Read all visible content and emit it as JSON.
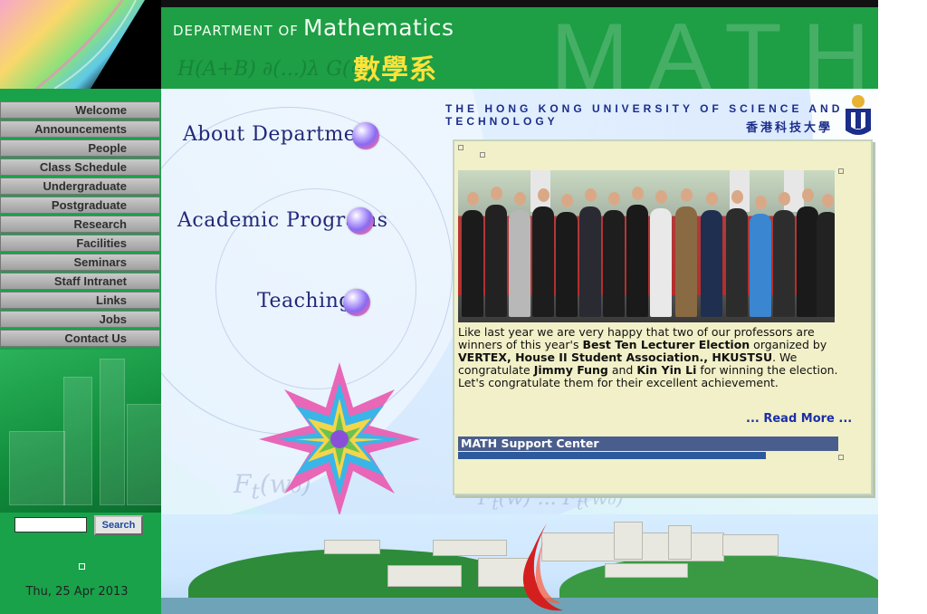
{
  "header": {
    "dept_prefix": "DEPARTMENT OF",
    "dept_name": "Mathematics",
    "dept_chinese": "數學系",
    "watermark": "MATH"
  },
  "nav": {
    "items": [
      {
        "label": "Welcome"
      },
      {
        "label": "Announcements"
      },
      {
        "label": "People"
      },
      {
        "label": "Class Schedule"
      },
      {
        "label": "Undergraduate"
      },
      {
        "label": "Postgraduate"
      },
      {
        "label": "Research"
      },
      {
        "label": "Facilities"
      },
      {
        "label": "Seminars"
      },
      {
        "label": "Staff Intranet"
      },
      {
        "label": "Links"
      },
      {
        "label": "Jobs"
      },
      {
        "label": "Contact Us"
      }
    ]
  },
  "search": {
    "value": "",
    "button_label": "Search"
  },
  "date": "Thu, 25 Apr 2013",
  "main_menu": {
    "about": "About Department",
    "programs": "Academic Programs",
    "teaching": "Teaching"
  },
  "university": {
    "name_en": "THE HONG KONG UNIVERSITY OF SCIENCE AND TECHNOLOGY",
    "name_cn": "香港科技大學"
  },
  "news": {
    "text_1": "Like last year we are very happy that two of our professors are winners of this year's ",
    "bold_1": "Best Ten Lecturer Election",
    "text_2": " organized by ",
    "bold_2": "VERTEX, House II Student Association., HKUSTSU",
    "text_3": ". We congratulate ",
    "bold_3": "Jimmy Fung",
    "text_4": " and ",
    "bold_4": "Kin Yin Li",
    "text_5": " for winning the election. Let's congratulate them for their excellent achievement.",
    "read_more": "... Read More ...",
    "support_center": "MATH Support Center"
  },
  "colors": {
    "header_green": "#1e9e45",
    "nav_text": "#2f2f2f",
    "link_blue": "#1c2fa8",
    "title_navy": "#1b2d8a"
  }
}
